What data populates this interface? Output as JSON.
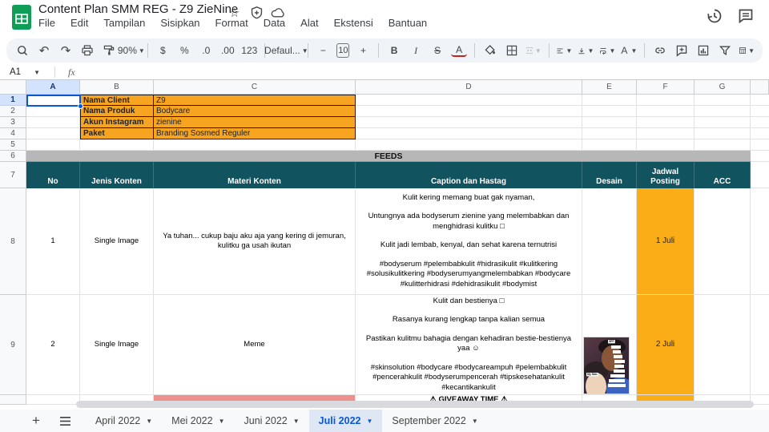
{
  "app": {
    "title": "Content Plan SMM REG - Z9 ZieNine",
    "menus": [
      "File",
      "Edit",
      "Tampilan",
      "Sisipkan",
      "Format",
      "Data",
      "Alat",
      "Ekstensi",
      "Bantuan"
    ]
  },
  "toolbar": {
    "zoom": "90%",
    "dollar": "$",
    "percent": "%",
    "decimal_decrease": ".0",
    "decimal_increase": ".00",
    "number_format": "123",
    "font_family": "Defaul...",
    "minus": "−",
    "font_size": "10",
    "plus": "+",
    "bold": "B",
    "italic": "I",
    "strikethrough": "S",
    "text_color": "A",
    "rotate": "A"
  },
  "formula_bar": {
    "cell_ref": "A1",
    "fx": "fx"
  },
  "grid": {
    "columns": [
      "A",
      "B",
      "C",
      "D",
      "E",
      "F",
      "G"
    ],
    "row_numbers": [
      "1",
      "2",
      "3",
      "4",
      "5",
      "6",
      "7",
      "8",
      "9"
    ],
    "info": [
      {
        "label": "Nama Client",
        "value": "Z9"
      },
      {
        "label": "Nama Produk",
        "value": "Bodycare"
      },
      {
        "label": "Akun Instagram",
        "value": "zienine"
      },
      {
        "label": "Paket",
        "value": "Branding Sosmed Reguler"
      }
    ],
    "section_title": "FEEDS",
    "headers": {
      "no": "No",
      "jenis": "Jenis Konten",
      "materi": "Materi Konten",
      "caption": "Caption dan Hastag",
      "desain": "Desain",
      "jadwal": "Jadwal Posting",
      "acc": "ACC"
    },
    "rows": [
      {
        "no": "1",
        "jenis": "Single Image",
        "materi": "Ya tuhan... cukup baju aku aja yang kering di jemuran, kulitku ga usah ikutan",
        "caption": [
          "Kulit kering memang buat gak nyaman,",
          "Untungnya ada bodyserum zienine yang melembabkan dan menghidrasi kulitku □",
          "Kulit jadi lembab, kenyal, dan sehat karena ternutrisi",
          "#bodyserum #pelembabkulit #hidrasikulit #kulitkering #solusikulitkering #bodyserumyangmelembabkan #bodycare #kulitterhidrasi #dehidrasikulit #bodymist"
        ],
        "jadwal": "1 Juli"
      },
      {
        "no": "2",
        "jenis": "Single Image",
        "materi": "Meme",
        "caption": [
          "Kulit dan bestienya □",
          "Rasanya kurang lengkap tanpa kalian semua",
          "Pastikan kulitmu bahagia dengan kehadiran bestie-bestienya yaa ☺",
          "#skinsolution #bodycare #bodycareampuh #pelembabkulit #pencerahkulit #bodyserumpencerah #tipskesehatankulit #kecantikankulit"
        ],
        "jadwal": "2 Juli"
      }
    ],
    "partial_row_caption": "⚠ GIVEAWAY TIME ⚠",
    "meme_labels": {
      "top": "SPF",
      "left": "My Skin"
    }
  },
  "tabs": {
    "items": [
      {
        "label": "April 2022"
      },
      {
        "label": "Mei 2022"
      },
      {
        "label": "Juni 2022"
      },
      {
        "label": "Juli 2022"
      },
      {
        "label": "September 2022"
      }
    ],
    "active": "Juli 2022"
  },
  "colors": {
    "info_orange": "#F7A521",
    "jadwal_orange": "#FBAD18",
    "header_teal": "#11535F",
    "feeds_gray": "#B7B7B7",
    "pink": "#EE918E",
    "selection_blue": "#0B57D0",
    "active_tab_bg": "#DFE7F5"
  }
}
